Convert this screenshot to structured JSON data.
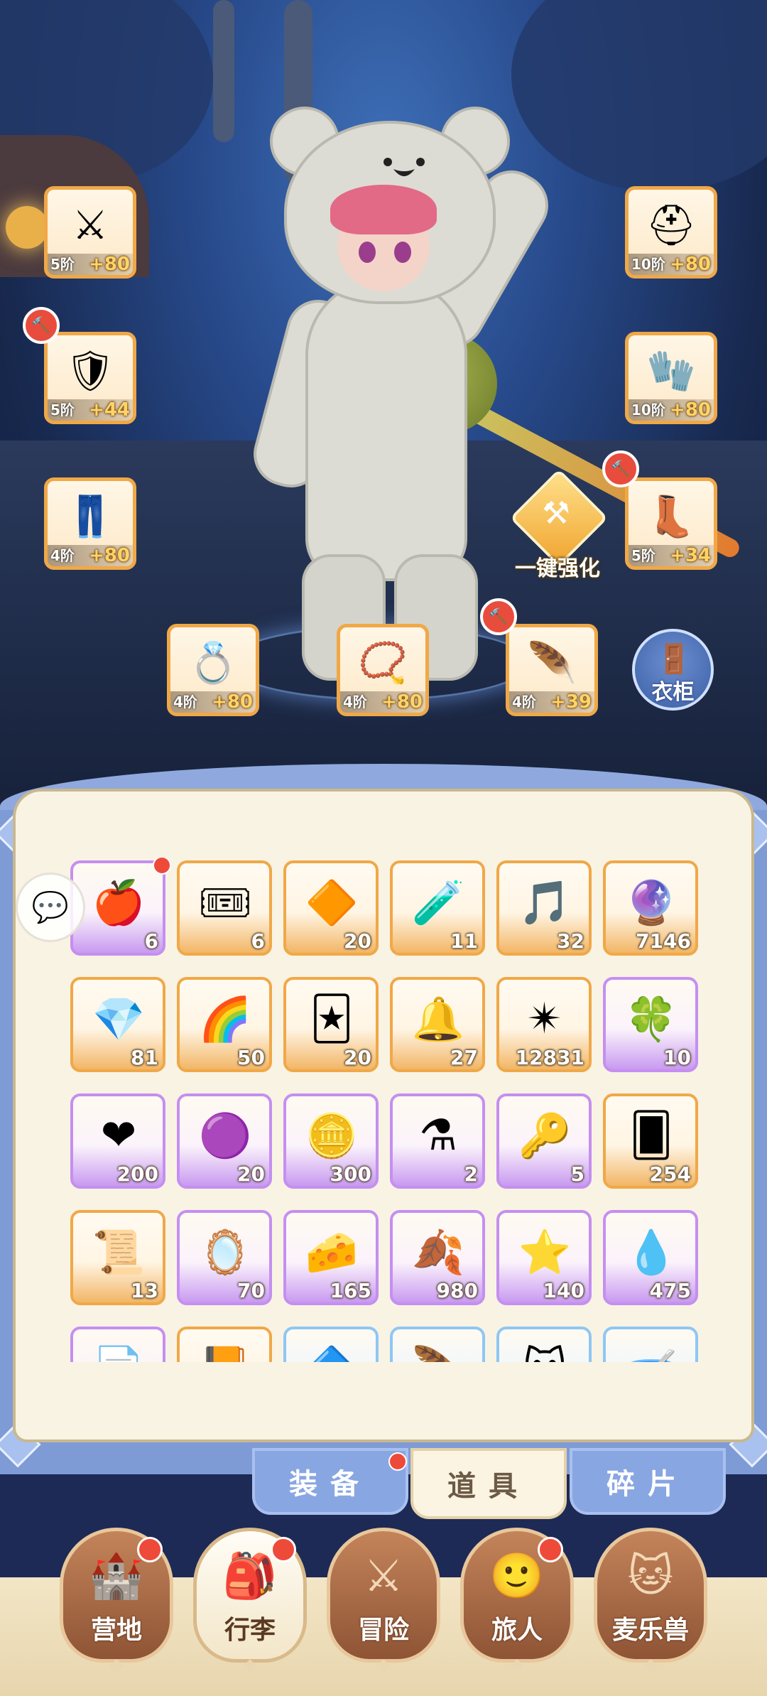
{
  "equipment": {
    "slots": [
      {
        "id": "weapon",
        "icon": "halberd-icon",
        "glyph": "⚔",
        "tier": "5阶",
        "bonus": "+80",
        "upgrade": false
      },
      {
        "id": "armor",
        "icon": "armor-icon",
        "glyph": "🛡",
        "tier": "5阶",
        "bonus": "+44",
        "upgrade": true
      },
      {
        "id": "pants",
        "icon": "pants-icon",
        "glyph": "👖",
        "tier": "4阶",
        "bonus": "+80",
        "upgrade": false
      },
      {
        "id": "helmet",
        "icon": "helmet-icon",
        "glyph": "⛑",
        "tier": "10阶",
        "bonus": "+80",
        "upgrade": false
      },
      {
        "id": "gloves",
        "icon": "gloves-icon",
        "glyph": "🧤",
        "tier": "10阶",
        "bonus": "+80",
        "upgrade": false
      },
      {
        "id": "boots",
        "icon": "boots-icon",
        "glyph": "👢",
        "tier": "5阶",
        "bonus": "+34",
        "upgrade": true
      },
      {
        "id": "ring",
        "icon": "ring-icon",
        "glyph": "💍",
        "tier": "4阶",
        "bonus": "+80",
        "upgrade": false
      },
      {
        "id": "necklace",
        "icon": "necklace-icon",
        "glyph": "📿",
        "tier": "4阶",
        "bonus": "+80",
        "upgrade": false
      },
      {
        "id": "earring",
        "icon": "earring-icon",
        "glyph": "🪶",
        "tier": "4阶",
        "bonus": "+39",
        "upgrade": true
      }
    ],
    "one_click_enhance": "一键强化",
    "wardrobe": "衣柜"
  },
  "inventory": {
    "items": [
      {
        "icon": "apple-icon",
        "glyph": "🍎",
        "count": "6",
        "rarity": "purple",
        "dot": true
      },
      {
        "icon": "ticket-icon",
        "glyph": "🎟",
        "count": "6",
        "rarity": "orange"
      },
      {
        "icon": "amber-gem-icon",
        "glyph": "🔶",
        "count": "20",
        "rarity": "orange"
      },
      {
        "icon": "blue-potion-icon",
        "glyph": "🧪",
        "count": "11",
        "rarity": "orange"
      },
      {
        "icon": "lyre-icon",
        "glyph": "🎵",
        "count": "32",
        "rarity": "orange"
      },
      {
        "icon": "portal-orb-icon",
        "glyph": "🔮",
        "count": "7146",
        "rarity": "orange"
      },
      {
        "icon": "ice-crystal-icon",
        "glyph": "💎",
        "count": "81",
        "rarity": "orange"
      },
      {
        "icon": "paint-tube-icon",
        "glyph": "🌈",
        "count": "50",
        "rarity": "orange"
      },
      {
        "icon": "outfit-card-icon",
        "glyph": "🃏",
        "count": "20",
        "rarity": "orange"
      },
      {
        "icon": "bell-icon",
        "glyph": "🔔",
        "count": "27",
        "rarity": "orange"
      },
      {
        "icon": "star-crystal-icon",
        "glyph": "✴",
        "count": "12831",
        "rarity": "orange"
      },
      {
        "icon": "bear-badge-icon",
        "glyph": "🍀",
        "count": "10",
        "rarity": "purple"
      },
      {
        "icon": "heart-icon",
        "glyph": "❤",
        "count": "200",
        "rarity": "purple"
      },
      {
        "icon": "purple-gem-icon",
        "glyph": "🟣",
        "count": "20",
        "rarity": "purple"
      },
      {
        "icon": "heart-coin-icon",
        "glyph": "🪙",
        "count": "300",
        "rarity": "purple"
      },
      {
        "icon": "red-potion-icon",
        "glyph": "⚗",
        "count": "2",
        "rarity": "purple"
      },
      {
        "icon": "gold-key-icon",
        "glyph": "🔑",
        "count": "5",
        "rarity": "purple"
      },
      {
        "icon": "blue-card-icon",
        "glyph": "🂠",
        "count": "254",
        "rarity": "orange"
      },
      {
        "icon": "gold-card-icon",
        "glyph": "📜",
        "count": "13",
        "rarity": "orange"
      },
      {
        "icon": "cat-mirror-icon",
        "glyph": "🪞",
        "count": "70",
        "rarity": "purple"
      },
      {
        "icon": "cheese-icon",
        "glyph": "🧀",
        "count": "165",
        "rarity": "purple"
      },
      {
        "icon": "gold-leaf-icon",
        "glyph": "🍂",
        "count": "980",
        "rarity": "purple"
      },
      {
        "icon": "star-cookie-icon",
        "glyph": "⭐",
        "count": "140",
        "rarity": "purple"
      },
      {
        "icon": "blue-slime-icon",
        "glyph": "💧",
        "count": "475",
        "rarity": "purple"
      },
      {
        "icon": "scroll-icon",
        "glyph": "📄",
        "count": "",
        "rarity": "purple"
      },
      {
        "icon": "book-icon",
        "glyph": "📙",
        "count": "",
        "rarity": "orange"
      },
      {
        "icon": "shard-icon",
        "glyph": "🔷",
        "count": "",
        "rarity": "blue"
      },
      {
        "icon": "feather-icon",
        "glyph": "🪶",
        "count": "",
        "rarity": "blue"
      },
      {
        "icon": "cat-badge-icon",
        "glyph": "🐱",
        "count": "",
        "rarity": "blue"
      },
      {
        "icon": "bowl-icon",
        "glyph": "🥣",
        "count": "",
        "rarity": "blue"
      }
    ]
  },
  "tabs": [
    {
      "label": "装备",
      "active": false,
      "dot": true
    },
    {
      "label": "道具",
      "active": true,
      "dot": false
    },
    {
      "label": "碎片",
      "active": false,
      "dot": false
    }
  ],
  "nav": [
    {
      "label": "营地",
      "icon": "castle-icon",
      "glyph": "🏰",
      "active": false,
      "dot": true
    },
    {
      "label": "行李",
      "icon": "backpack-icon",
      "glyph": "🎒",
      "active": true,
      "dot": true
    },
    {
      "label": "冒险",
      "icon": "crossed-swords-icon",
      "glyph": "⚔",
      "active": false,
      "dot": false
    },
    {
      "label": "旅人",
      "icon": "traveler-icon",
      "glyph": "🙂",
      "active": false,
      "dot": true
    },
    {
      "label": "麦乐兽",
      "icon": "cat-pet-icon",
      "glyph": "🐱",
      "active": false,
      "dot": false
    }
  ]
}
